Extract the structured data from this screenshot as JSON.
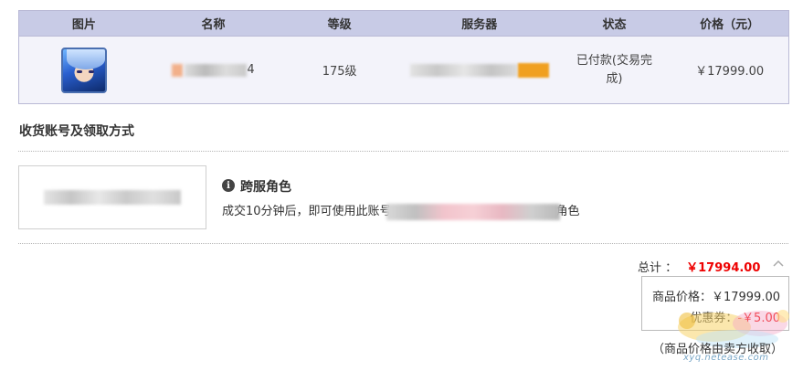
{
  "table": {
    "headers": [
      "图片",
      "名称",
      "等级",
      "服务器",
      "状态",
      "价格（元）"
    ],
    "row": {
      "name_suffix": "4",
      "level": "175级",
      "status": "已付款(交易完成)",
      "price": "￥17999.00"
    }
  },
  "receipt": {
    "section_title": "收货账号及领取方式",
    "cross_title": "跨服角色",
    "cross_desc_prefix": "成交10分钟后，即可使用此账号",
    "cross_desc_suffix": "角色"
  },
  "summary": {
    "total_label": "总计 ：",
    "total_amount": "￥17994.00",
    "goods_price_label": "商品价格：",
    "goods_price_value": "￥17999.00",
    "coupon_label": "优惠券：",
    "coupon_value": "-￥5.00",
    "note": "（商品价格由卖方收取）"
  },
  "watermark": {
    "url": "xyq.netease.com"
  },
  "colors": {
    "header_bg": "#c8cbe6",
    "row_bg": "#f3f3fa",
    "accent_red": "#ee0000",
    "border": "#b9b9d6"
  },
  "icons": {
    "info": "info-circle-icon",
    "collapse": "chevron-up-icon"
  }
}
